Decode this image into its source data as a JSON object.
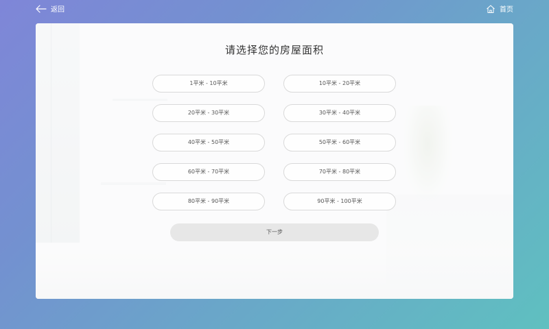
{
  "topbar": {
    "back_label": "返回",
    "home_label": "首页",
    "back_icon": "arrow-left-icon",
    "home_icon": "home-icon"
  },
  "main": {
    "title": "请选择您的房屋面积",
    "options": [
      "1平米 - 10平米",
      "10平米 - 20平米",
      "20平米 - 30平米",
      "30平米 - 40平米",
      "40平米 - 50平米",
      "50平米 - 60平米",
      "60平米 - 70平米",
      "70平米 - 80平米",
      "80平米 - 90平米",
      "90平米 - 100平米"
    ],
    "next_label": "下一步"
  },
  "colors": {
    "background_start": "#7f86d8",
    "background_end": "#5fc0c0",
    "panel": "#f6f7f8",
    "button_border": "#d9d9d9",
    "next_button": "#e7e7e7"
  }
}
